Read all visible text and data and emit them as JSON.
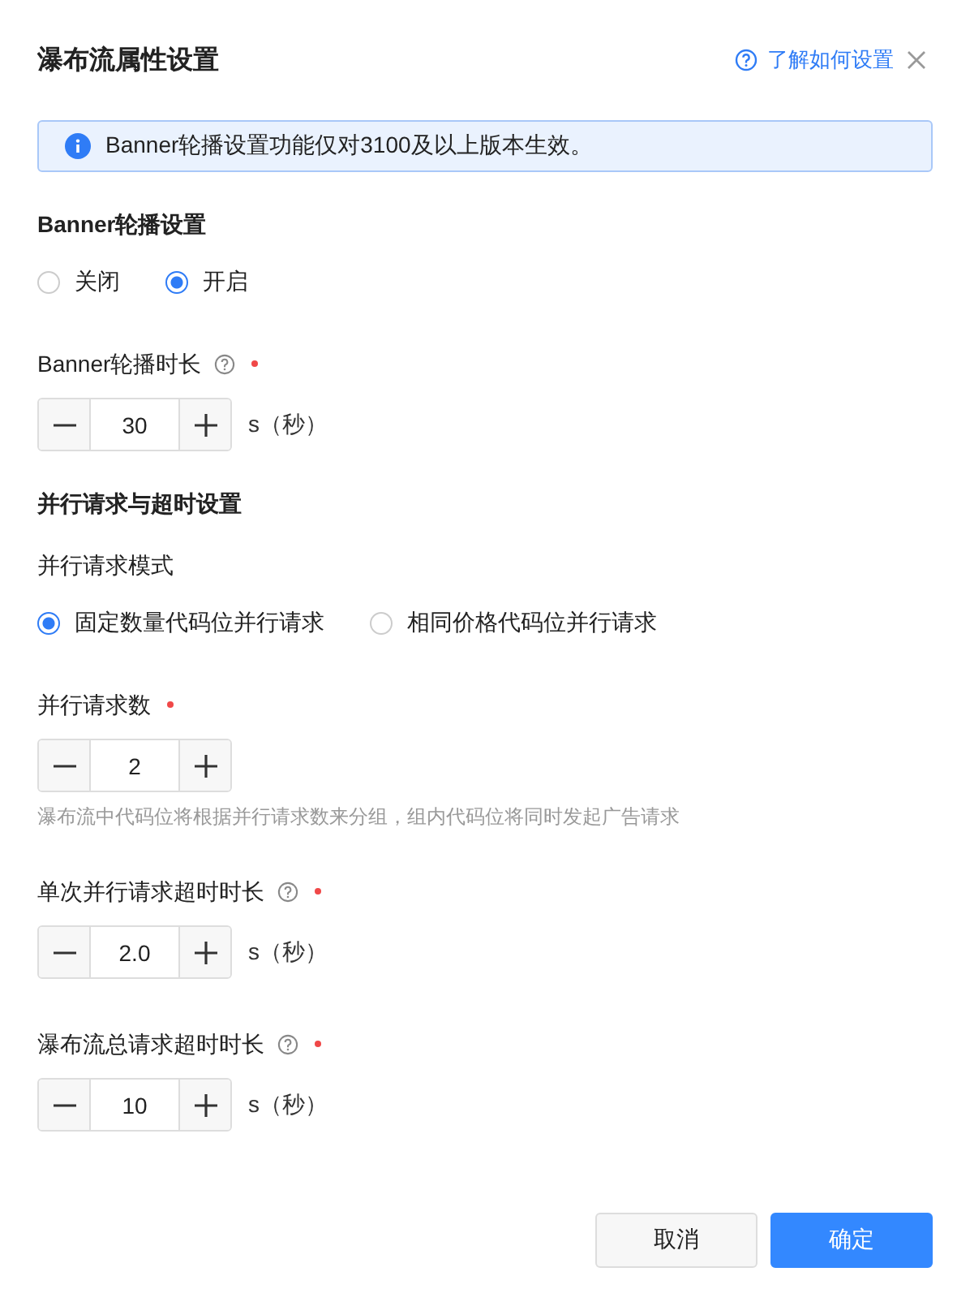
{
  "dialog": {
    "title": "瀑布流属性设置",
    "help_link": "了解如何设置"
  },
  "notice": "Banner轮播设置功能仅对3100及以上版本生效。",
  "items": [
    {
      "kind": "heading",
      "text": "Banner轮播设置"
    },
    {
      "kind": "radios",
      "options": [
        {
          "label": "关闭",
          "selected": false
        },
        {
          "label": "开启",
          "selected": true
        }
      ]
    },
    {
      "kind": "stepper",
      "label": "Banner轮播时长",
      "help": true,
      "required": true,
      "value": "30",
      "unit": "s（秒）"
    },
    {
      "kind": "heading",
      "text": "并行请求与超时设置"
    },
    {
      "kind": "label",
      "text": "并行请求模式"
    },
    {
      "kind": "radios",
      "options": [
        {
          "label": "固定数量代码位并行请求",
          "selected": true
        },
        {
          "label": "相同价格代码位并行请求",
          "selected": false
        }
      ]
    },
    {
      "kind": "stepper",
      "label": "并行请求数",
      "help": false,
      "required": true,
      "value": "2",
      "hint": "瀑布流中代码位将根据并行请求数来分组，组内代码位将同时发起广告请求"
    },
    {
      "kind": "stepper",
      "label": "单次并行请求超时时长",
      "help": true,
      "required": true,
      "value": "2.0",
      "unit": "s（秒）"
    },
    {
      "kind": "stepper",
      "label": "瀑布流总请求超时时长",
      "help": true,
      "required": true,
      "value": "10",
      "unit": "s（秒）"
    }
  ],
  "buttons": [
    {
      "label": "取消",
      "primary": false
    },
    {
      "label": "确定",
      "primary": true
    }
  ]
}
